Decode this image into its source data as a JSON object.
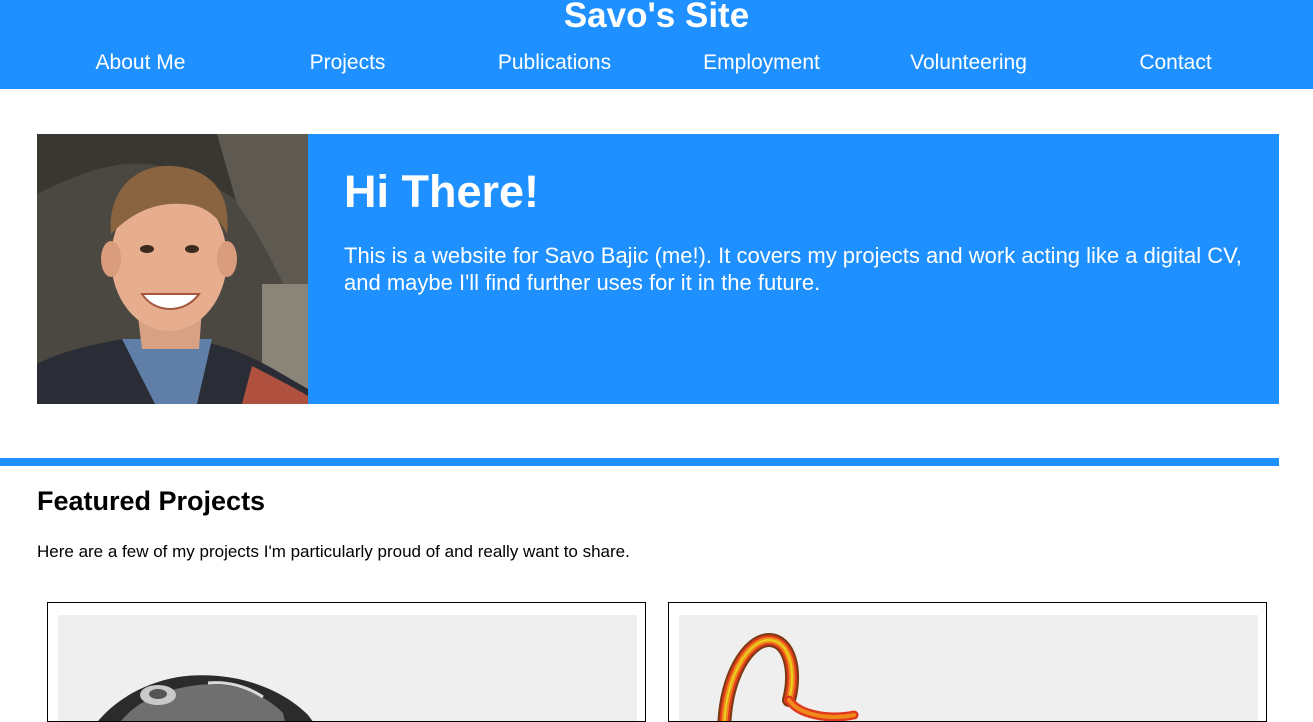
{
  "header": {
    "title": "Savo's Site",
    "nav": [
      {
        "label": "About Me"
      },
      {
        "label": "Projects"
      },
      {
        "label": "Publications"
      },
      {
        "label": "Employment"
      },
      {
        "label": "Volunteering"
      },
      {
        "label": "Contact"
      }
    ]
  },
  "hero": {
    "heading": "Hi There!",
    "text": "This is a website for Savo Bajic (me!). It covers my projects and work acting like a digital CV, and maybe I'll find further uses for it in the future."
  },
  "featured": {
    "title": "Featured Projects",
    "description": "Here are a few of my projects I'm particularly proud of and really want to share."
  },
  "colors": {
    "accent": "#1e90ff",
    "text_on_accent": "#ffffff",
    "card_border": "#000000"
  }
}
